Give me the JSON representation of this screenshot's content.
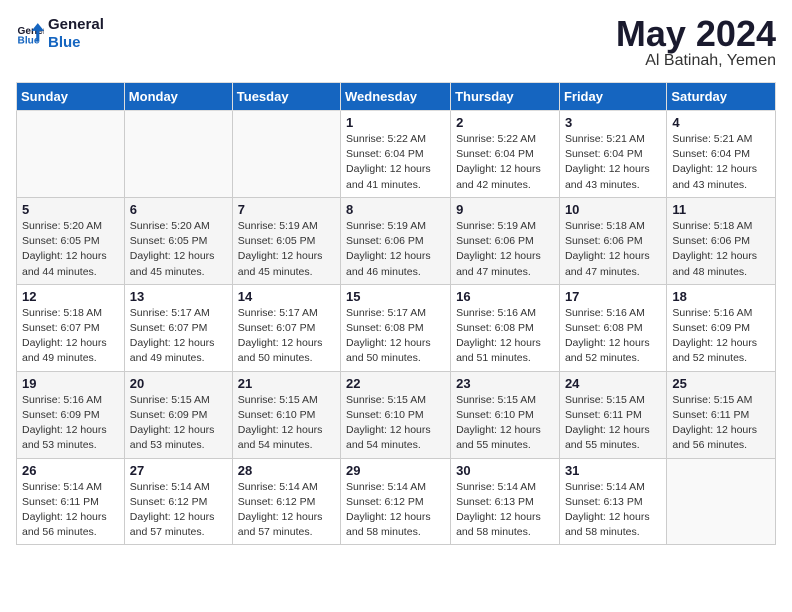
{
  "logo": {
    "line1": "General",
    "line2": "Blue"
  },
  "title": "May 2024",
  "subtitle": "Al Batinah, Yemen",
  "days_header": [
    "Sunday",
    "Monday",
    "Tuesday",
    "Wednesday",
    "Thursday",
    "Friday",
    "Saturday"
  ],
  "weeks": [
    [
      {
        "day": "",
        "info": ""
      },
      {
        "day": "",
        "info": ""
      },
      {
        "day": "",
        "info": ""
      },
      {
        "day": "1",
        "info": "Sunrise: 5:22 AM\nSunset: 6:04 PM\nDaylight: 12 hours\nand 41 minutes."
      },
      {
        "day": "2",
        "info": "Sunrise: 5:22 AM\nSunset: 6:04 PM\nDaylight: 12 hours\nand 42 minutes."
      },
      {
        "day": "3",
        "info": "Sunrise: 5:21 AM\nSunset: 6:04 PM\nDaylight: 12 hours\nand 43 minutes."
      },
      {
        "day": "4",
        "info": "Sunrise: 5:21 AM\nSunset: 6:04 PM\nDaylight: 12 hours\nand 43 minutes."
      }
    ],
    [
      {
        "day": "5",
        "info": "Sunrise: 5:20 AM\nSunset: 6:05 PM\nDaylight: 12 hours\nand 44 minutes."
      },
      {
        "day": "6",
        "info": "Sunrise: 5:20 AM\nSunset: 6:05 PM\nDaylight: 12 hours\nand 45 minutes."
      },
      {
        "day": "7",
        "info": "Sunrise: 5:19 AM\nSunset: 6:05 PM\nDaylight: 12 hours\nand 45 minutes."
      },
      {
        "day": "8",
        "info": "Sunrise: 5:19 AM\nSunset: 6:06 PM\nDaylight: 12 hours\nand 46 minutes."
      },
      {
        "day": "9",
        "info": "Sunrise: 5:19 AM\nSunset: 6:06 PM\nDaylight: 12 hours\nand 47 minutes."
      },
      {
        "day": "10",
        "info": "Sunrise: 5:18 AM\nSunset: 6:06 PM\nDaylight: 12 hours\nand 47 minutes."
      },
      {
        "day": "11",
        "info": "Sunrise: 5:18 AM\nSunset: 6:06 PM\nDaylight: 12 hours\nand 48 minutes."
      }
    ],
    [
      {
        "day": "12",
        "info": "Sunrise: 5:18 AM\nSunset: 6:07 PM\nDaylight: 12 hours\nand 49 minutes."
      },
      {
        "day": "13",
        "info": "Sunrise: 5:17 AM\nSunset: 6:07 PM\nDaylight: 12 hours\nand 49 minutes."
      },
      {
        "day": "14",
        "info": "Sunrise: 5:17 AM\nSunset: 6:07 PM\nDaylight: 12 hours\nand 50 minutes."
      },
      {
        "day": "15",
        "info": "Sunrise: 5:17 AM\nSunset: 6:08 PM\nDaylight: 12 hours\nand 50 minutes."
      },
      {
        "day": "16",
        "info": "Sunrise: 5:16 AM\nSunset: 6:08 PM\nDaylight: 12 hours\nand 51 minutes."
      },
      {
        "day": "17",
        "info": "Sunrise: 5:16 AM\nSunset: 6:08 PM\nDaylight: 12 hours\nand 52 minutes."
      },
      {
        "day": "18",
        "info": "Sunrise: 5:16 AM\nSunset: 6:09 PM\nDaylight: 12 hours\nand 52 minutes."
      }
    ],
    [
      {
        "day": "19",
        "info": "Sunrise: 5:16 AM\nSunset: 6:09 PM\nDaylight: 12 hours\nand 53 minutes."
      },
      {
        "day": "20",
        "info": "Sunrise: 5:15 AM\nSunset: 6:09 PM\nDaylight: 12 hours\nand 53 minutes."
      },
      {
        "day": "21",
        "info": "Sunrise: 5:15 AM\nSunset: 6:10 PM\nDaylight: 12 hours\nand 54 minutes."
      },
      {
        "day": "22",
        "info": "Sunrise: 5:15 AM\nSunset: 6:10 PM\nDaylight: 12 hours\nand 54 minutes."
      },
      {
        "day": "23",
        "info": "Sunrise: 5:15 AM\nSunset: 6:10 PM\nDaylight: 12 hours\nand 55 minutes."
      },
      {
        "day": "24",
        "info": "Sunrise: 5:15 AM\nSunset: 6:11 PM\nDaylight: 12 hours\nand 55 minutes."
      },
      {
        "day": "25",
        "info": "Sunrise: 5:15 AM\nSunset: 6:11 PM\nDaylight: 12 hours\nand 56 minutes."
      }
    ],
    [
      {
        "day": "26",
        "info": "Sunrise: 5:14 AM\nSunset: 6:11 PM\nDaylight: 12 hours\nand 56 minutes."
      },
      {
        "day": "27",
        "info": "Sunrise: 5:14 AM\nSunset: 6:12 PM\nDaylight: 12 hours\nand 57 minutes."
      },
      {
        "day": "28",
        "info": "Sunrise: 5:14 AM\nSunset: 6:12 PM\nDaylight: 12 hours\nand 57 minutes."
      },
      {
        "day": "29",
        "info": "Sunrise: 5:14 AM\nSunset: 6:12 PM\nDaylight: 12 hours\nand 58 minutes."
      },
      {
        "day": "30",
        "info": "Sunrise: 5:14 AM\nSunset: 6:13 PM\nDaylight: 12 hours\nand 58 minutes."
      },
      {
        "day": "31",
        "info": "Sunrise: 5:14 AM\nSunset: 6:13 PM\nDaylight: 12 hours\nand 58 minutes."
      },
      {
        "day": "",
        "info": ""
      }
    ]
  ]
}
